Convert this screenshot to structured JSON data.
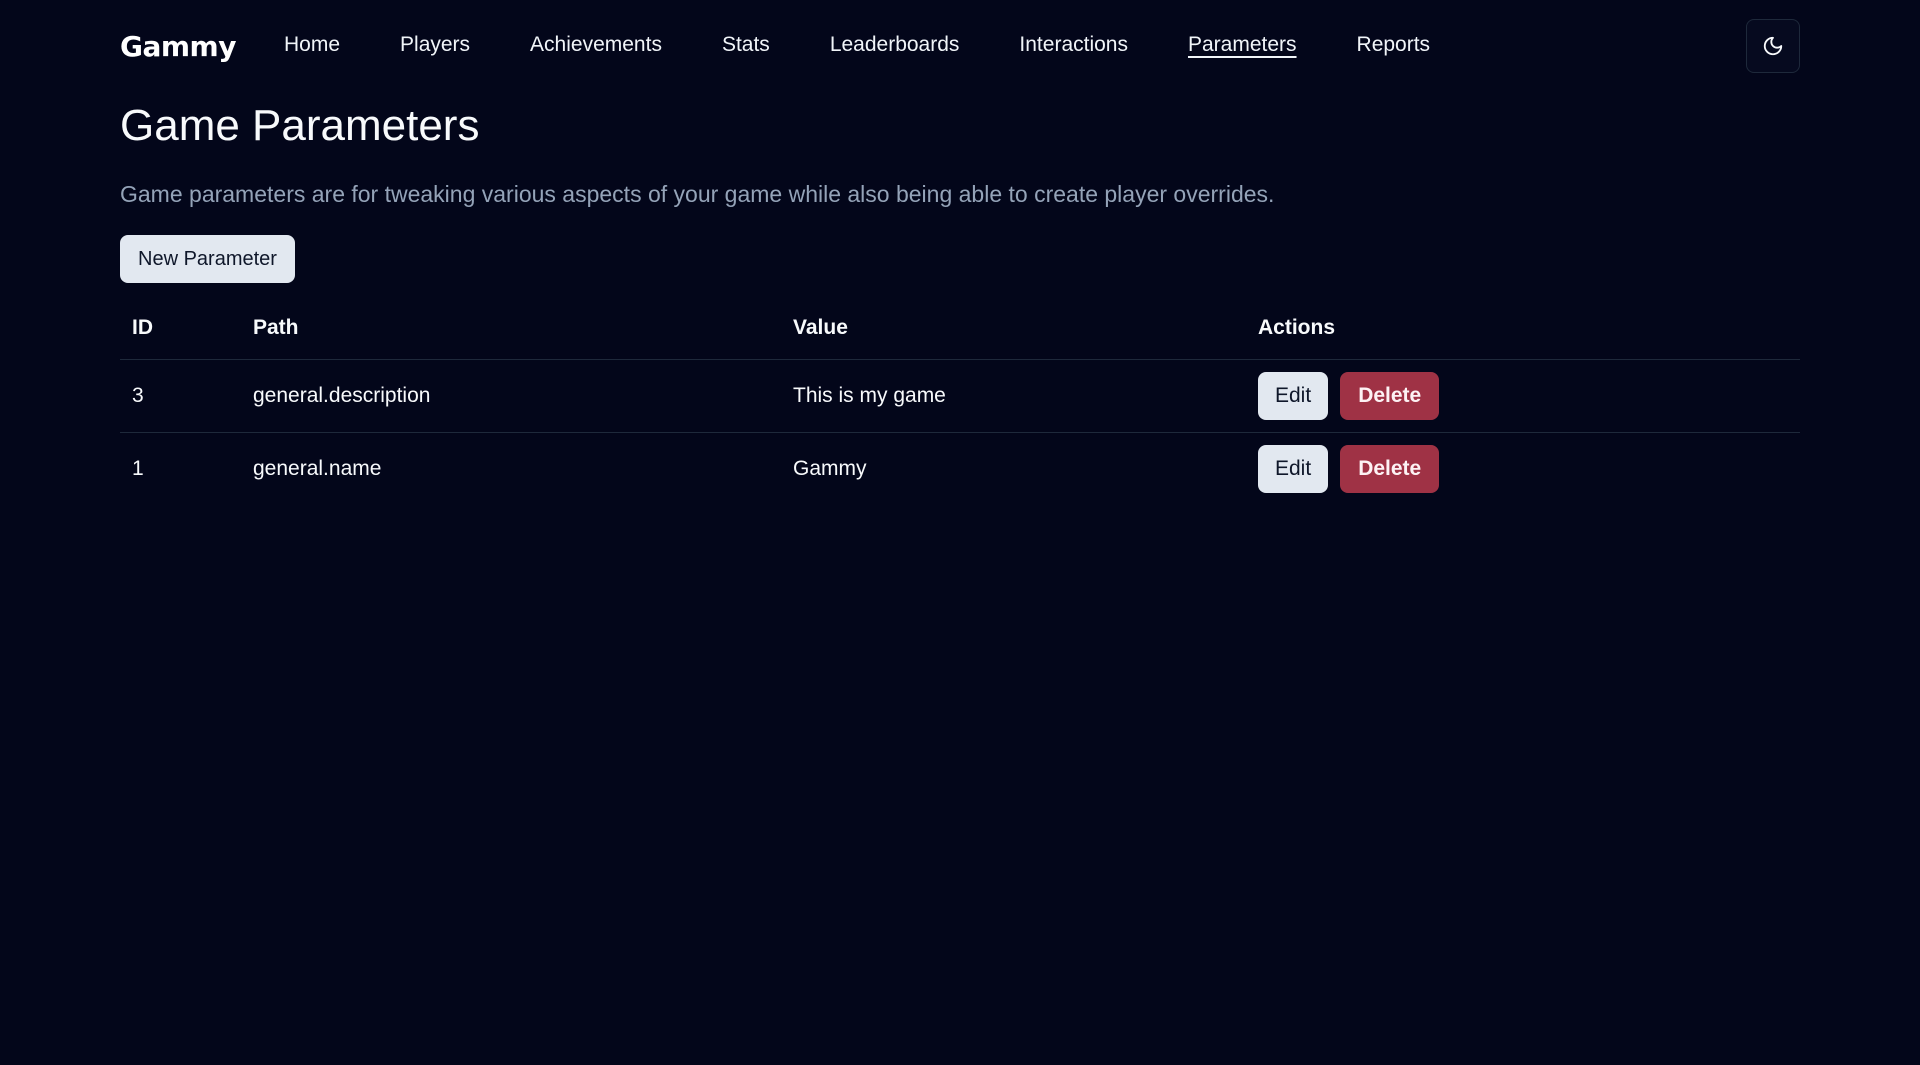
{
  "brand": "Gammy",
  "nav": {
    "items": [
      {
        "label": "Home"
      },
      {
        "label": "Players"
      },
      {
        "label": "Achievements"
      },
      {
        "label": "Stats"
      },
      {
        "label": "Leaderboards"
      },
      {
        "label": "Interactions"
      },
      {
        "label": "Parameters",
        "active": true
      },
      {
        "label": "Reports"
      }
    ],
    "theme_toggle_icon": "moon-icon"
  },
  "page": {
    "title": "Game Parameters",
    "description": "Game parameters are for tweaking various aspects of your game while also being able to create player overrides.",
    "new_button_label": "New Parameter"
  },
  "table": {
    "headers": [
      "ID",
      "Path",
      "Value",
      "Actions"
    ],
    "rows": [
      {
        "id": "3",
        "path": "general.description",
        "value": "This is my game",
        "edit_label": "Edit",
        "delete_label": "Delete"
      },
      {
        "id": "1",
        "path": "general.name",
        "value": "Gammy",
        "edit_label": "Edit",
        "delete_label": "Delete"
      }
    ]
  },
  "colors": {
    "background": "#03061a",
    "delete": "#9f3245",
    "button_light": "#e2e8f0",
    "muted_text": "#94a3b8"
  }
}
